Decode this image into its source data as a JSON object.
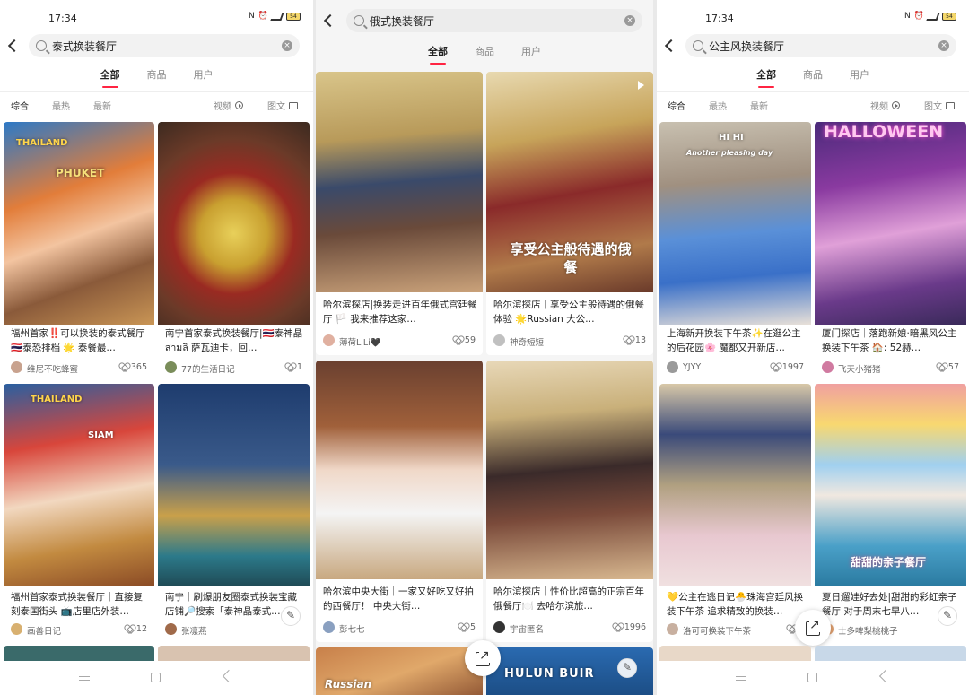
{
  "panels": [
    {
      "status": {
        "time": "17:34",
        "battery": "54"
      },
      "search": {
        "query": "泰式换装餐厅"
      },
      "tabs": [
        "全部",
        "商品",
        "用户"
      ],
      "filters": {
        "left": [
          "综合",
          "最热",
          "最新"
        ],
        "video": "视频",
        "image": "图文"
      },
      "cards": [
        {
          "title": "福州首家‼️可以换装的泰式餐厅🇹🇭泰恐排档 🌟 泰餐最…",
          "author": "维尼不吃蜂蜜",
          "likes": "365",
          "image_text": "THAILAND",
          "image_text2": "PHUKET"
        },
        {
          "title": "南宁首家泰式换装餐厅|🇹🇭泰神晶 สามลิ 萨瓦迪卡，回…",
          "author": "77的生活日记",
          "likes": "1",
          "image_text": "",
          "image_text2": ""
        },
        {
          "title": "福州首家泰式换装餐厅｜直接复刻泰国街头 📺店里店外装…",
          "author": "画善日记",
          "likes": "12",
          "image_text": "THAILAND",
          "image_text2": "SIAM"
        },
        {
          "title": "南宁｜刷爆朋友圈泰式换装宝藏店铺🔎搜索「泰神晶泰式…",
          "author": "张凛燕",
          "likes": "",
          "image_text": "",
          "image_text2": ""
        }
      ]
    },
    {
      "status": {
        "time": "",
        "battery": ""
      },
      "search": {
        "query": "俄式换装餐厅"
      },
      "tabs": [
        "全部",
        "商品",
        "用户"
      ],
      "cards": [
        {
          "title": "哈尔滨探店|换装走进百年俄式宫廷餐厅 🏳️ 我来推荐这家…",
          "author": "薄荷LiLi🖤",
          "likes": "59",
          "image_text": "",
          "image_text2": ""
        },
        {
          "title": "哈尔滨探店｜享受公主般待遇的俄餐体验 🌟Russian 大公…",
          "author": "神奇短短",
          "likes": "13",
          "image_text": "享受公主般待遇的俄餐",
          "image_text2": ""
        },
        {
          "title": "哈尔滨中央大街｜一家又好吃又好拍的西餐厅！ 中央大街…",
          "author": "彭七七",
          "likes": "5",
          "image_text": "",
          "image_text2": ""
        },
        {
          "title": "哈尔滨探店｜性价比超高的正宗百年俄餐厅🍽️ 去哈尔滨旅…",
          "author": "宇宙匿名",
          "likes": "1996",
          "image_text": "",
          "image_text2": ""
        },
        {
          "title": "",
          "author": "",
          "likes": "",
          "image_text": "Russian",
          "image_text2": ""
        },
        {
          "title": "",
          "author": "",
          "likes": "",
          "image_text": "HULUN BUIR",
          "image_text2": ""
        }
      ]
    },
    {
      "status": {
        "time": "17:34",
        "battery": "54"
      },
      "search": {
        "query": "公主风换装餐厅"
      },
      "tabs": [
        "全部",
        "商品",
        "用户"
      ],
      "filters": {
        "left": [
          "综合",
          "最热",
          "最新"
        ],
        "video": "视频",
        "image": "图文"
      },
      "cards": [
        {
          "title": "上海新开换装下午茶✨在逛公主的后花园🌸 魔都又开新店…",
          "author": "YJYY",
          "likes": "1997",
          "image_text": "HI HI",
          "image_text2": "Another pleasing day"
        },
        {
          "title": "厦门探店｜落跑新娘·暗黑风公主换装下午茶 🏠: 52赫…",
          "author": "飞天小猪猪",
          "likes": "57",
          "image_text": "HALLOWEEN",
          "image_text2": ""
        },
        {
          "title": "💛公主在逃日记🐣珠海宫廷风换装下午茶 追求精致的换装…",
          "author": "洛可可换装下午茶",
          "likes": "6",
          "image_text": "",
          "image_text2": ""
        },
        {
          "title": "夏日遛娃好去处|甜甜的彩虹亲子餐厅 对于周末七早八…",
          "author": "士多啤梨桃桃子",
          "likes": "",
          "image_text": "甜甜的亲子餐厅",
          "image_text2": ""
        }
      ]
    }
  ],
  "colors": {
    "accent": "#ff2442"
  }
}
